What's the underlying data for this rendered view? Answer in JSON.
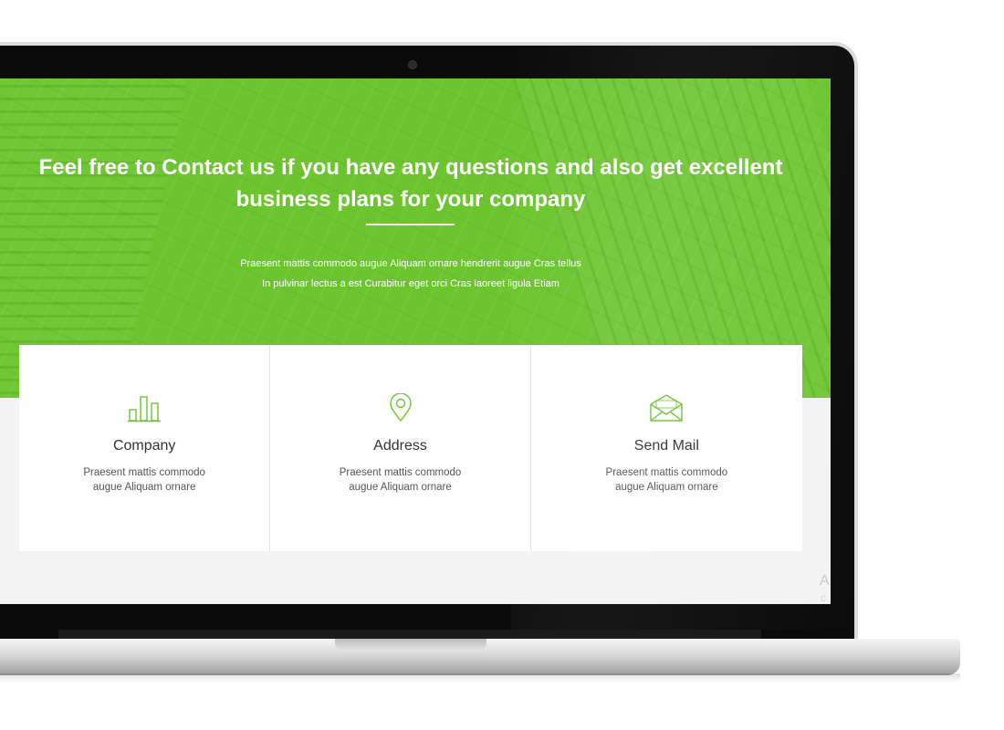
{
  "hero": {
    "title_line1": "Feel free to Contact us if you have any questions and also get excellent",
    "title_line2": "business plans for your company",
    "sub_line1": "Praesent mattis commodo augue Aliquam ornare hendrerit augue Cras tellus",
    "sub_line2": "In pulvinar lectus a est Curabitur eget orci Cras laoreet ligula Etiam"
  },
  "cards": [
    {
      "title": "Company",
      "text_line1": "Praesent mattis commodo",
      "text_line2": "augue Aliquam ornare",
      "icon": "bar-chart-icon"
    },
    {
      "title": "Address",
      "text_line1": "Praesent mattis commodo",
      "text_line2": "augue Aliquam ornare",
      "icon": "map-pin-icon"
    },
    {
      "title": "Send Mail",
      "text_line1": "Praesent mattis commodo",
      "text_line2": "augue Aliquam ornare",
      "icon": "envelope-icon"
    }
  ],
  "offscreen": {
    "letter1": "A",
    "letter2": "c"
  },
  "colors": {
    "accent": "#6cc52f",
    "background": "#f3f3f3",
    "card": "#ffffff",
    "icon": "#6cc52f"
  }
}
